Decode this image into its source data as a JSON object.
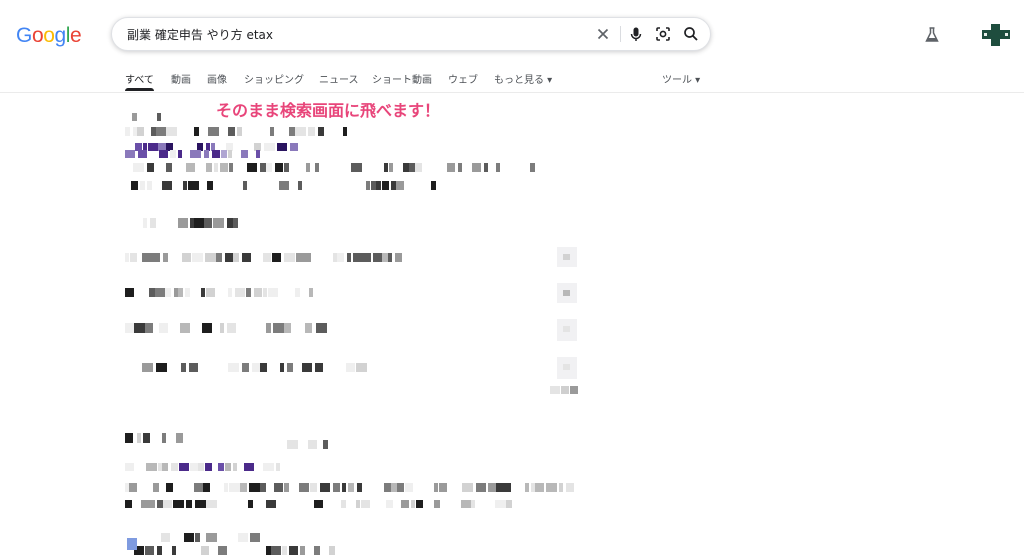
{
  "logo": {
    "letters": [
      "G",
      "o",
      "o",
      "g",
      "l",
      "e"
    ],
    "colors": [
      "#4285f4",
      "#ea4335",
      "#fbbc05",
      "#4285f4",
      "#34a853",
      "#ea4335"
    ]
  },
  "search": {
    "query": "副業 確定申告 やり方 etax"
  },
  "icons": {
    "clear": "close-icon",
    "voice": "microphone-icon",
    "lens": "camera-lens-icon",
    "search": "search-icon",
    "labs": "flask-icon",
    "account": "avatar-icon"
  },
  "tabs": [
    {
      "label": "すべて",
      "active": true
    },
    {
      "label": "動画"
    },
    {
      "label": "画像"
    },
    {
      "label": "ショッピング"
    },
    {
      "label": "ニュース"
    },
    {
      "label": "ショート動画"
    },
    {
      "label": "ウェブ"
    },
    {
      "label": "もっと見る ▾"
    }
  ],
  "tools": {
    "label": "ツール ▾"
  },
  "annotation": {
    "text": "そのまま検索画面に飛べます！"
  },
  "colors": {
    "accent": "#e8457a",
    "avatar": "#1e4d3e",
    "link_purple": "#4b2a8a"
  }
}
